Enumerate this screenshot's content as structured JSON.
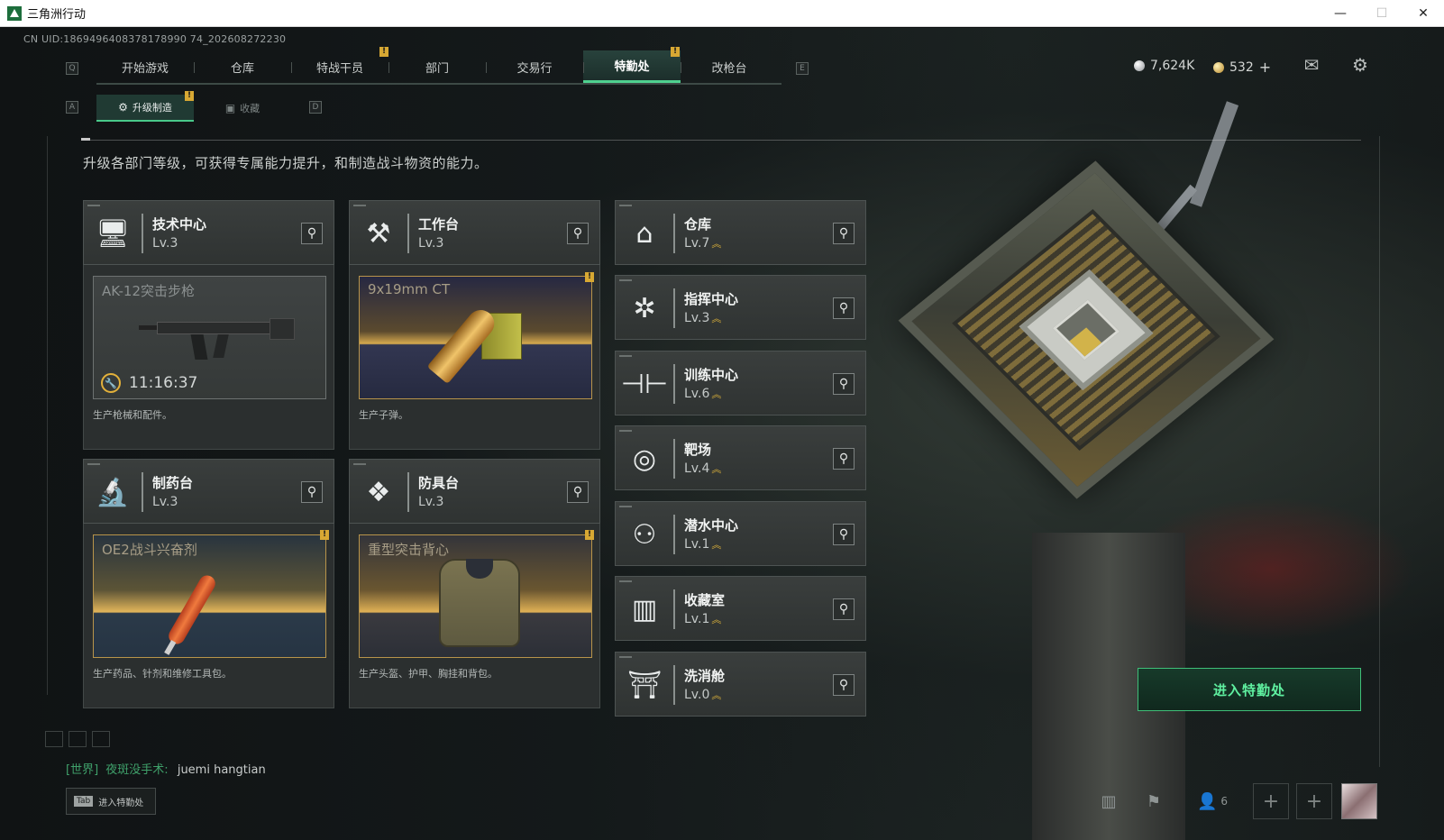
{
  "window": {
    "title": "三角洲行动",
    "min": "—",
    "max": "☐",
    "close": "✕"
  },
  "uid": "CN UID:1869496408378178990 74_202608272230",
  "keys": {
    "q": "Q",
    "e": "E",
    "a": "A",
    "d": "D"
  },
  "nav": {
    "tabs": [
      {
        "label": "开始游戏"
      },
      {
        "label": "仓库"
      },
      {
        "label": "特战干员"
      },
      {
        "label": "部门"
      },
      {
        "label": "交易行"
      },
      {
        "label": "特勤处",
        "active": true
      },
      {
        "label": "改枪台"
      }
    ]
  },
  "alert_mark": "!",
  "currency": {
    "silver": "7,624K",
    "gold": "532",
    "plus": "+"
  },
  "top_icons": {
    "mail": "mail-icon",
    "settings": "gear-icon"
  },
  "subnav": {
    "upgrade": "升级制造",
    "collection": "收藏"
  },
  "description": "升级各部门等级，可获得专属能力提升，和制造战斗物资的能力。",
  "level_chevron": "︽",
  "departments_left": [
    {
      "name": "技术中心",
      "level": "Lv.3",
      "icon": "computer-icon",
      "product": "AK-12突击步枪",
      "timer": "11:16:37",
      "desc": "生产枪械和配件。"
    },
    {
      "name": "工作台",
      "level": "Lv.3",
      "icon": "tools-icon",
      "product": "9x19mm CT",
      "desc": "生产子弹。"
    },
    {
      "name": "制药台",
      "level": "Lv.3",
      "icon": "microscope-icon",
      "product": "OE2战斗兴奋剂",
      "desc": "生产药品、针剂和维修工具包。"
    },
    {
      "name": "防具台",
      "level": "Lv.3",
      "icon": "cubes-icon",
      "product": "重型突击背心",
      "desc": "生产头盔、护甲、胸挂和背包。"
    }
  ],
  "departments_right": [
    {
      "name": "仓库",
      "level": "Lv.7",
      "icon": "warehouse-icon"
    },
    {
      "name": "指挥中心",
      "level": "Lv.3",
      "icon": "command-icon"
    },
    {
      "name": "训练中心",
      "level": "Lv.6",
      "icon": "dumbbell-icon"
    },
    {
      "name": "靶场",
      "level": "Lv.4",
      "icon": "target-icon"
    },
    {
      "name": "潜水中心",
      "level": "Lv.1",
      "icon": "diving-mask-icon"
    },
    {
      "name": "收藏室",
      "level": "Lv.1",
      "icon": "collection-icon"
    },
    {
      "name": "洗消舱",
      "level": "Lv.0",
      "icon": "decon-icon"
    }
  ],
  "enter_button": "进入特勤处",
  "chat": {
    "channel": "[世界]",
    "name": "夜斑没手术:",
    "message": "juemi  hangtian"
  },
  "tab_hint": {
    "key": "Tab",
    "label": "进入特勤处"
  },
  "friends_count": "6",
  "add": "+"
}
